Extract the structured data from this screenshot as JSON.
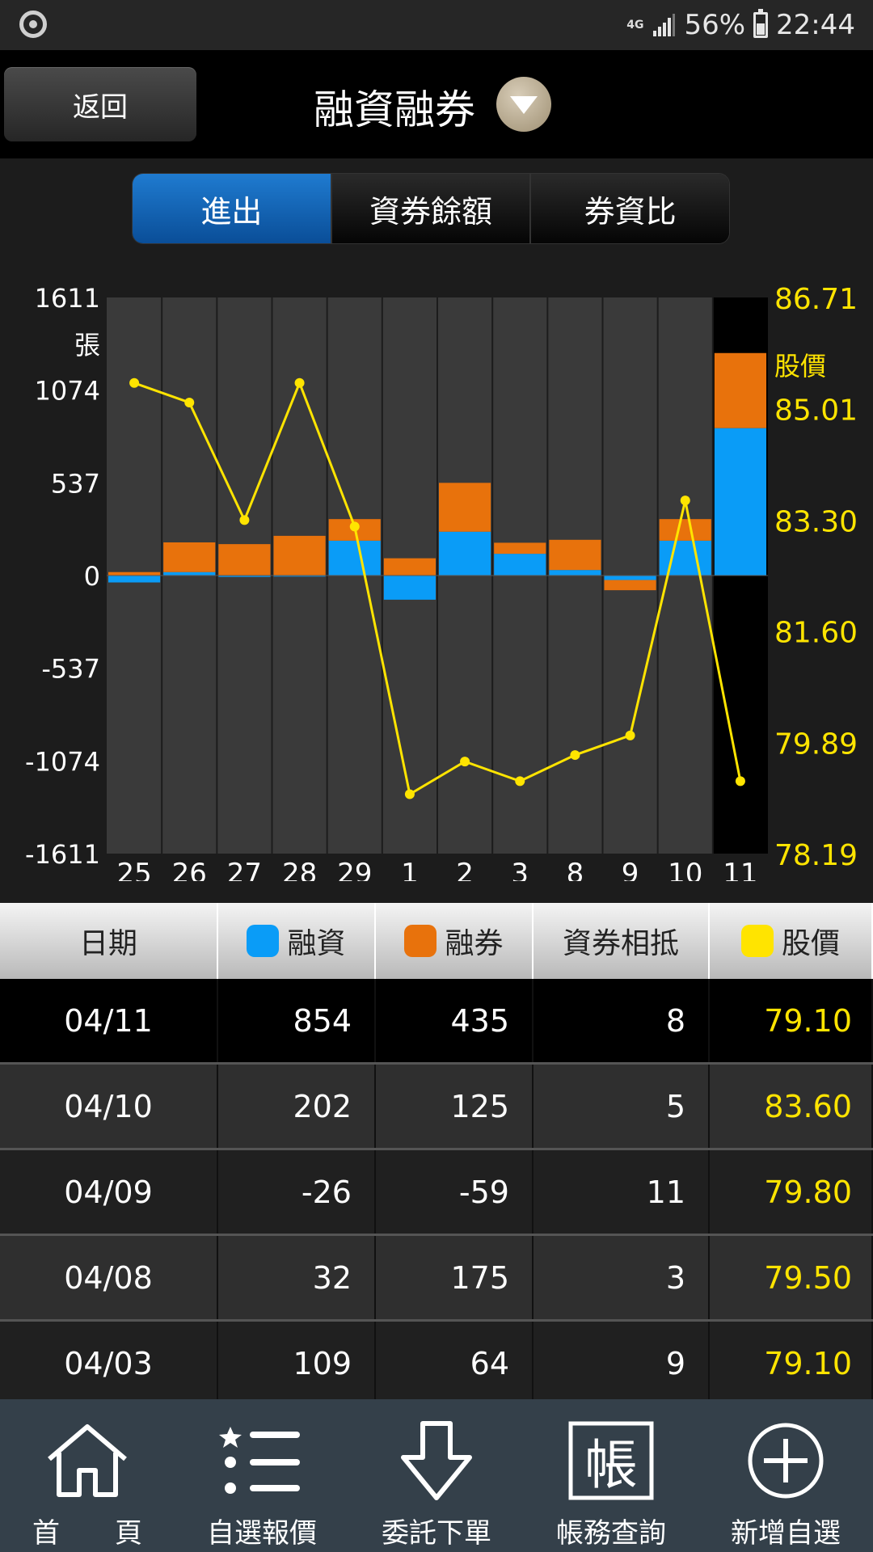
{
  "status": {
    "network": "4G",
    "battery": "56%",
    "time": "22:44"
  },
  "header": {
    "back_label": "返回",
    "title": "融資融券"
  },
  "tabs": [
    {
      "label": "進出",
      "active": true
    },
    {
      "label": "資券餘額",
      "active": false
    },
    {
      "label": "券資比",
      "active": false
    }
  ],
  "chart_data": {
    "type": "bar",
    "categories": [
      "25",
      "26",
      "27",
      "28",
      "29",
      "1",
      "2",
      "3",
      "8",
      "9",
      "10",
      "11"
    ],
    "series": [
      {
        "name": "融資",
        "color": "#0a9cf7",
        "values": [
          -40,
          20,
          -8,
          -6,
          202,
          -140,
          254,
          126,
          32,
          -26,
          202,
          854
        ]
      },
      {
        "name": "融券",
        "color": "#e8720c",
        "values": [
          20,
          172,
          182,
          230,
          125,
          100,
          283,
          64,
          175,
          -59,
          125,
          435
        ]
      }
    ],
    "line": {
      "name": "股價",
      "color": "#ffe400",
      "values": [
        85.4,
        85.1,
        83.3,
        85.4,
        83.2,
        79.1,
        79.6,
        79.3,
        79.7,
        80.0,
        83.6,
        79.3
      ]
    },
    "left_axis": {
      "unit": "張",
      "ticks": [
        "1611",
        "1074",
        "537",
        "0",
        "-537",
        "-1074",
        "-1611"
      ],
      "range": [
        -1611,
        1611
      ]
    },
    "right_axis": {
      "unit": "股價",
      "ticks": [
        "86.71",
        "85.01",
        "83.30",
        "81.60",
        "79.89",
        "78.19"
      ],
      "range": [
        78.19,
        86.71
      ]
    },
    "highlight_index": 11
  },
  "table": {
    "headers": {
      "date": "日期",
      "margin": "融資",
      "short": "融券",
      "offset": "資券相抵",
      "price": "股價"
    },
    "colors": {
      "margin": "#0a9cf7",
      "short": "#e8720c",
      "price": "#ffe400"
    },
    "rows": [
      {
        "date": "04/11",
        "margin": "854",
        "short": "435",
        "offset": "8",
        "price": "79.10"
      },
      {
        "date": "04/10",
        "margin": "202",
        "short": "125",
        "offset": "5",
        "price": "83.60"
      },
      {
        "date": "04/09",
        "margin": "-26",
        "short": "-59",
        "offset": "11",
        "price": "79.80"
      },
      {
        "date": "04/08",
        "margin": "32",
        "short": "175",
        "offset": "3",
        "price": "79.50"
      },
      {
        "date": "04/03",
        "margin": "109",
        "short": "64",
        "offset": "9",
        "price": "79.10"
      }
    ]
  },
  "nav": [
    {
      "label": "首　　頁",
      "icon": "home-icon"
    },
    {
      "label": "自選報價",
      "icon": "watchlist-icon"
    },
    {
      "label": "委託下單",
      "icon": "order-icon"
    },
    {
      "label": "帳務查詢",
      "icon": "account-icon"
    },
    {
      "label": "新增自選",
      "icon": "add-icon"
    }
  ]
}
